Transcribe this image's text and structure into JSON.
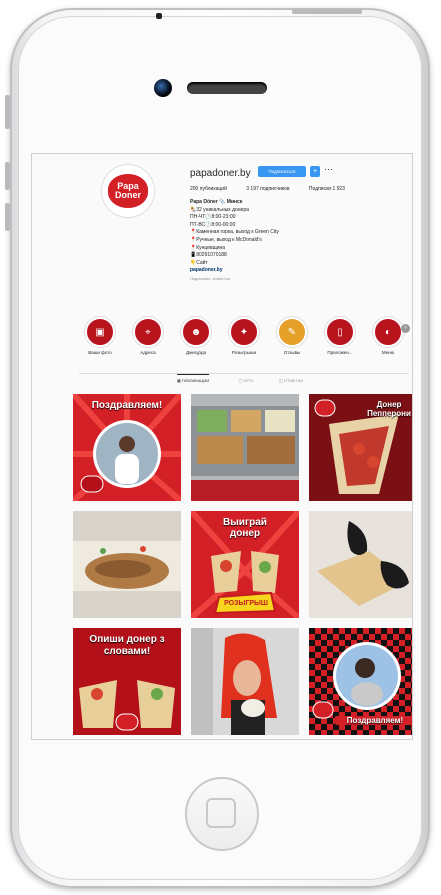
{
  "profile": {
    "username": "papadoner.by",
    "follow_label": "Подписаться",
    "plus_label": "+",
    "more_label": "···",
    "logo_line1": "Papa",
    "logo_line2": "Doner",
    "stats": {
      "posts": "200 публикаций",
      "followers": "3 197 подписчиков",
      "following": "Подписки 1 923"
    },
    "bio": {
      "name": "Papa Döner 📎 Минск",
      "lines": [
        "🌯32 уникальных донера",
        "ПН-ЧТ🕛8:00-23:00",
        "ПТ-ВС🕛8:00-00:00",
        "📍Каменная горка, выход к Green City",
        "📍Ручные, выход к McDonald's",
        "📍Кунцевщина",
        "📱80291070188",
        "👇Сайт"
      ],
      "link": "papadoner.by",
      "followed_by": "Подписано: shrike.bar"
    }
  },
  "stories": [
    {
      "label": "Ваши фото",
      "icon": "photo-icon"
    },
    {
      "label": "Адреса",
      "icon": "map-pin-icon"
    },
    {
      "label": "Джигурда",
      "icon": "face-icon"
    },
    {
      "label": "Розыгрыши",
      "icon": "gift-icon"
    },
    {
      "label": "Отзывы",
      "icon": "chat-icon"
    },
    {
      "label": "Приложен...",
      "icon": "phone-icon"
    },
    {
      "label": "Меню",
      "icon": "food-icon"
    }
  ],
  "tabs": [
    {
      "label": "▦ ПУБЛИКАЦИИ",
      "active": true
    },
    {
      "label": "▢ IGTV",
      "active": false
    },
    {
      "label": "◫ ОТМЕТКИ",
      "active": false
    }
  ],
  "posts": [
    {
      "text": "Поздравляем!"
    },
    {
      "text": ""
    },
    {
      "text": "Донер Пепперони"
    },
    {
      "text": ""
    },
    {
      "text": "Выиграй донер"
    },
    {
      "text": ""
    },
    {
      "text": "Опиши донер з словами!"
    },
    {
      "text": ""
    },
    {
      "text": "Поздравляем!"
    }
  ],
  "badges": {
    "sticker": "РОЗЫГРЫШ"
  },
  "colors": {
    "brand_red": "#d31f26",
    "follow_blue": "#3897f0"
  }
}
